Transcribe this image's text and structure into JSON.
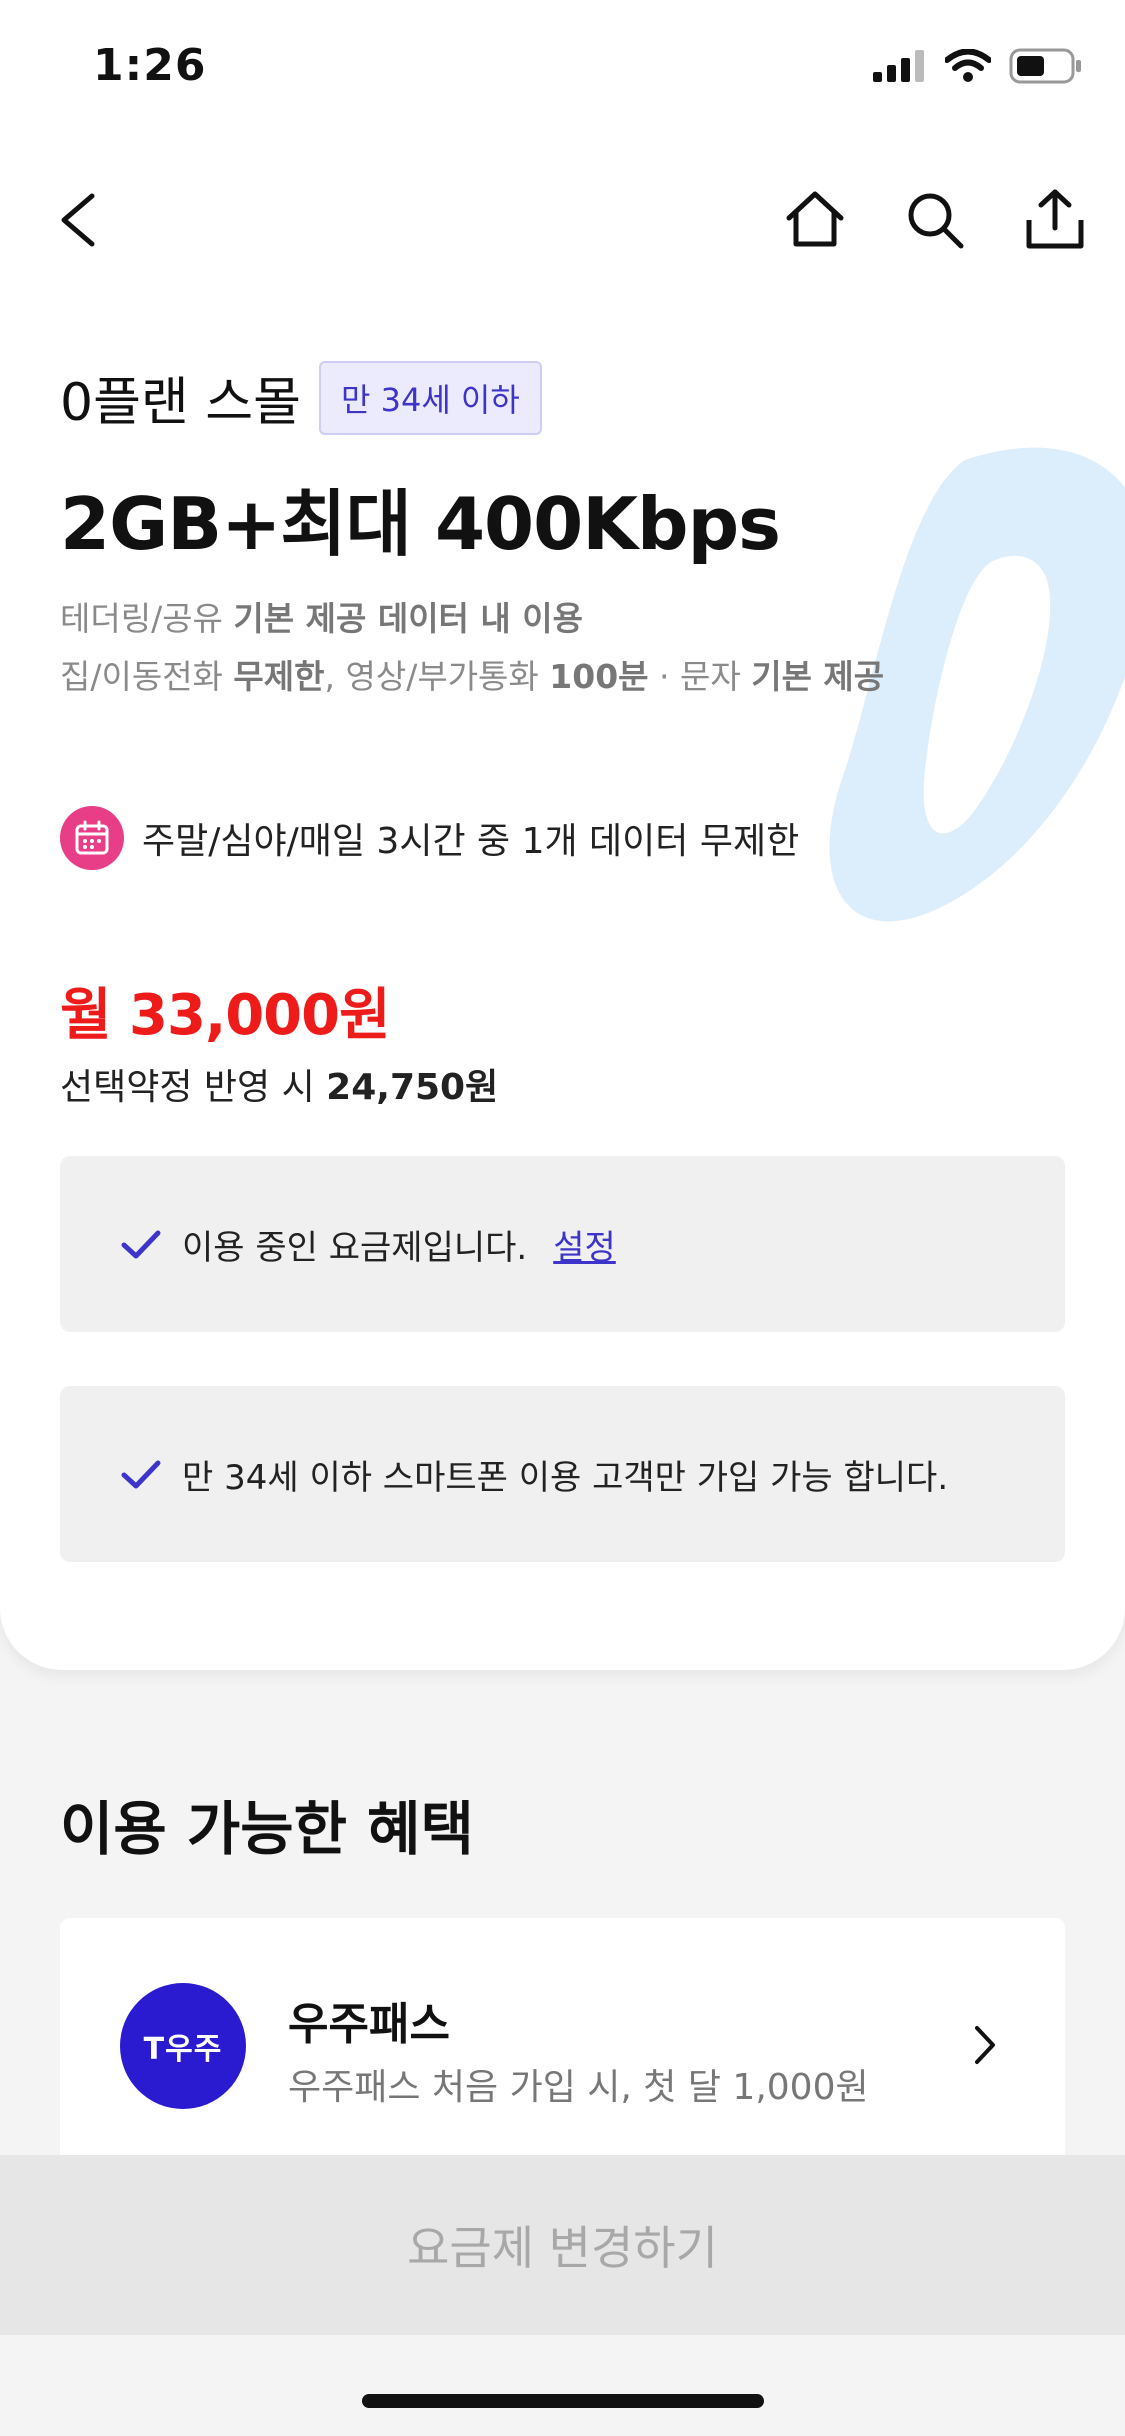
{
  "status_bar": {
    "time": "1:26"
  },
  "nav": {
    "back_icon": "chevron-left-icon",
    "home_icon": "home-icon",
    "search_icon": "search-icon",
    "share_icon": "share-icon"
  },
  "plan": {
    "name": "0플랜 스몰",
    "age_badge": "만 34세 이하",
    "data_title": "2GB+최대 400Kbps",
    "desc1": {
      "prefix": "테더링/공유 ",
      "bold": "기본 제공 데이터 내 이용"
    },
    "desc2": {
      "part1": "집/이동전화 ",
      "bold1": "무제한",
      "part2": ", 영상/부가통화 ",
      "bold2": "100분",
      "part3": " · 문자 ",
      "bold3": "기본 제공"
    },
    "unlimited_text": "주말/심야/매일 3시간 중 1개 데이터 무제한",
    "price": "월 33,000원",
    "discount_prefix": "선택약정 반영 시 ",
    "discount_value": "24,750원"
  },
  "notices": {
    "current": "이용 중인 요금제입니다.",
    "settings_link": "설정",
    "eligibility": "만 34세 이하 스마트폰 이용 고객만 가입 가능 합니다."
  },
  "benefits": {
    "title": "이용 가능한 혜택",
    "items": [
      {
        "logo_text": "T우주",
        "name": "우주패스",
        "desc": "우주패스 처음 가입 시, 첫 달 1,000원"
      }
    ]
  },
  "cta": {
    "label": "요금제 변경하기"
  },
  "colors": {
    "accent": "#3d34c9",
    "price_red": "#ee1b1b",
    "calendar_pink": "#e83d87",
    "uzu_blue": "#2b1bd0",
    "watermark_blue": "#dcedfb"
  }
}
